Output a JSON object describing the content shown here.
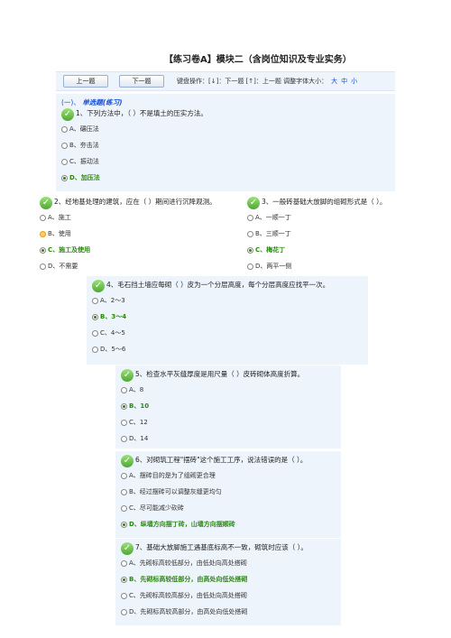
{
  "header": {
    "title": "【练习卷A】模块二（含岗位知识及专业实务）",
    "prev_button": "上一题",
    "next_button": "下一题",
    "keyboard_hint": "键盘操作：[↓]：下一题 [↑]：上一题   调整字体大小：",
    "font_large": "大",
    "font_medium": "中",
    "font_small": "小"
  },
  "section": {
    "index": "(一)、",
    "name": "单选题(练习)"
  },
  "questions": [
    {
      "text": "1、下列方法中，（   ）不是填土的压实方法。",
      "options": [
        "A、碾压法",
        "B、夯击法",
        "C、振动法",
        "D、加压法"
      ]
    },
    {
      "text": "2、经地基处理的建筑，应在（ ）期间进行沉降观测。",
      "options": [
        "A、施工",
        "B、使用",
        "C、施工及使用",
        "D、不需要"
      ]
    },
    {
      "text": "3、一般砖基础大放脚的组砌形式是（   ）。",
      "options": [
        "A、一顺一丁",
        "B、三顺一丁",
        "C、梅花丁",
        "D、两平一侧"
      ]
    },
    {
      "text": "4、毛石挡土墙应每砌（ ）皮为一个分层高度，每个分层高度应找平一次。",
      "options": [
        "A、2～3",
        "B、3～4",
        "C、4～5",
        "D、5～6"
      ]
    },
    {
      "text": "5、检查水平灰缝厚度是用尺量（   ）皮砖砌体高度折算。",
      "options": [
        "A、8",
        "B、10",
        "C、12",
        "D、14"
      ]
    },
    {
      "text": "6、对砌筑工程\"摆砖\"这个施工工序，说法错误的是（ ）。",
      "options": [
        "A、摆砖目的是为了组砌更合理",
        "B、经过摆砖可以调整灰缝更均匀",
        "C、尽可能减少砍砖",
        "D、纵墙方向摆丁砖，山墙方向摆顺砖"
      ]
    },
    {
      "text": "7、基础大放脚施工遇基底标高不一致，砌筑时应该（ ）。",
      "options": [
        "A、先砌标高较低部分，由低处向高处搭砌",
        "B、先砌标高较低部分，由高处向低处搭砌",
        "C、先砌标高较高部分，由低处向高处搭砌",
        "D、先砌标高较高部分，由高处向低处搭砌"
      ]
    }
  ]
}
